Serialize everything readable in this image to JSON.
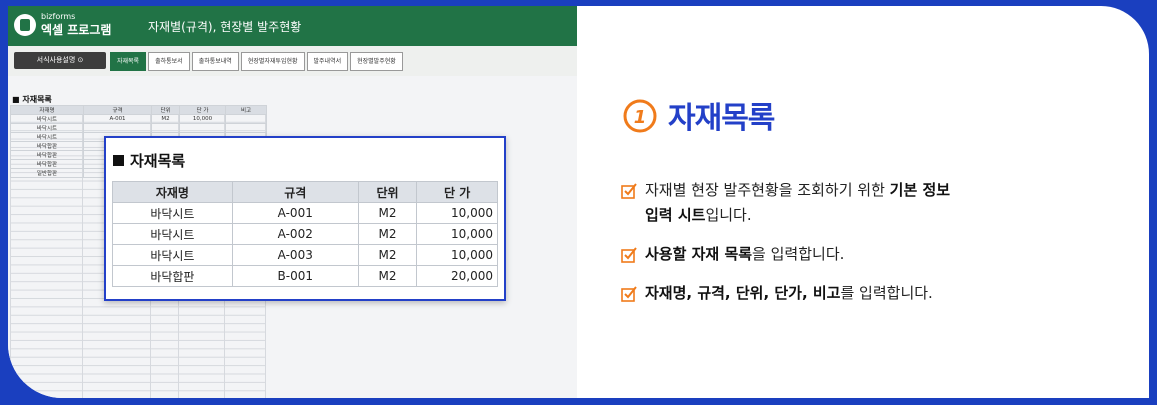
{
  "app": {
    "logo_small": "bizforms",
    "logo_big": "엑셀 프로그램",
    "title": "자재별(규격), 현장별 발주현황"
  },
  "toolbar": {
    "guide_button": "서식사용설명 ⊙",
    "tabs": [
      "자재목록",
      "출하통보서",
      "출하통보내역",
      "현장별자재투입현황",
      "발주내역서",
      "현장별발주현황"
    ]
  },
  "mini_sheet": {
    "title": "■ 자재목록",
    "headers": [
      "자재명",
      "규격",
      "단위",
      "단 가",
      "비고"
    ],
    "rows": [
      [
        "바닥시트",
        "A-001",
        "M2",
        "10,000",
        ""
      ],
      [
        "바닥시트",
        "",
        "",
        "",
        ""
      ],
      [
        "바닥시트",
        "",
        "",
        "",
        ""
      ],
      [
        "바닥합판",
        "",
        "",
        "",
        ""
      ],
      [
        "바닥합판",
        "",
        "",
        "",
        ""
      ],
      [
        "바닥합판",
        "",
        "",
        "",
        ""
      ],
      [
        "일반합판",
        "",
        "",
        "",
        ""
      ]
    ]
  },
  "zoom_table": {
    "title": "자재목록",
    "headers": [
      "자재명",
      "규격",
      "단위",
      "단 가"
    ],
    "rows": [
      [
        "바닥시트",
        "A-001",
        "M2",
        "10,000"
      ],
      [
        "바닥시트",
        "A-002",
        "M2",
        "10,000"
      ],
      [
        "바닥시트",
        "A-003",
        "M2",
        "10,000"
      ],
      [
        "바닥합판",
        "B-001",
        "M2",
        "20,000"
      ]
    ]
  },
  "section": {
    "number": "1",
    "title": "자재목록",
    "accent": "#2340c8",
    "check_color": "#f07b1b"
  },
  "bullets": {
    "b1_part1": "자재별 현장 발주현황을 조회하기 위한 ",
    "b1_bold": "기본 정보",
    "b1_bold2": "입력 시트",
    "b1_part2": "입니다.",
    "b2_bold": "사용할 자재 목록",
    "b2_part": "을 입력합니다.",
    "b3_bold": "자재명, 규격, 단위, 단가, 비고",
    "b3_part": "를 입력합니다."
  }
}
